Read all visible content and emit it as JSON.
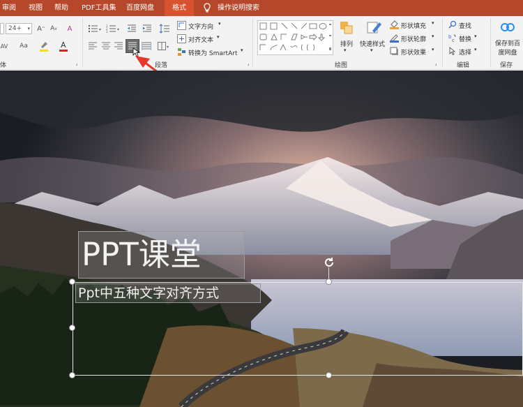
{
  "tabs": [
    {
      "label": "审阅",
      "active": false
    },
    {
      "label": "视图",
      "active": false
    },
    {
      "label": "帮助",
      "active": false
    },
    {
      "label": "PDF工具集",
      "active": false
    },
    {
      "label": "百度网盘",
      "active": false
    },
    {
      "label": "格式",
      "active": true
    }
  ],
  "tell_me": {
    "label": "操作说明搜索",
    "icon": "lightbulb-icon"
  },
  "font": {
    "size_value": "24+",
    "group_label": "体"
  },
  "paragraph": {
    "group_label": "段落",
    "text_direction": "文字方向",
    "align_text": "对齐文本",
    "convert_smartart": "转换为 SmartArt"
  },
  "drawing": {
    "group_label": "绘图",
    "arrange": "排列",
    "quick_styles": "快速样式",
    "shape_fill": "形状填充",
    "shape_outline": "形状轮廓",
    "shape_effects": "形状效果"
  },
  "editing": {
    "group_label": "编辑",
    "find": "查找",
    "replace": "替换",
    "select": "选择"
  },
  "save": {
    "group_label": "保存",
    "save_to_baidu": "保存到百度网盘"
  },
  "slide": {
    "title": "PPT课堂",
    "subtitle": "Ppt中五种文字对齐方式"
  },
  "colors": {
    "accent": "#b7472a",
    "active_tab": "#d7522f",
    "annotation_arrow": "#e8372d"
  }
}
